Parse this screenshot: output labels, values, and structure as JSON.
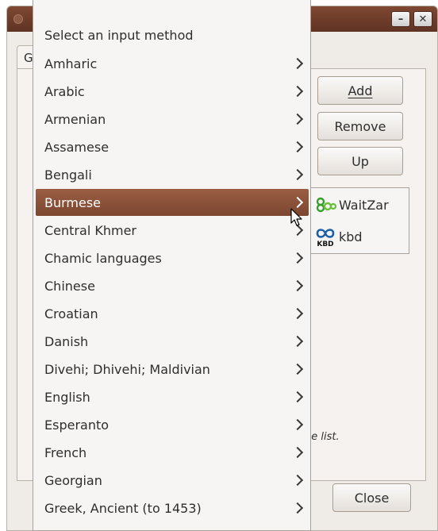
{
  "window": {
    "tab_label": "G",
    "buttons": {
      "add": "Add",
      "remove": "Remove",
      "up": "Up"
    },
    "hint_fragment": "he list.",
    "close_label": "Close",
    "titlebar_color": "#6e3d2a"
  },
  "menu": {
    "title": "Select an input method",
    "items": [
      {
        "label": "Amharic"
      },
      {
        "label": "Arabic"
      },
      {
        "label": "Armenian"
      },
      {
        "label": "Assamese"
      },
      {
        "label": "Bengali"
      },
      {
        "label": "Burmese",
        "selected": true
      },
      {
        "label": "Central Khmer"
      },
      {
        "label": "Chamic languages"
      },
      {
        "label": "Chinese"
      },
      {
        "label": "Croatian"
      },
      {
        "label": "Danish"
      },
      {
        "label": "Divehi; Dhivehi; Maldivian"
      },
      {
        "label": "English"
      },
      {
        "label": "Esperanto"
      },
      {
        "label": "French"
      },
      {
        "label": "Georgian"
      },
      {
        "label": "Greek, Ancient (to 1453)"
      }
    ],
    "selected_color": "#8b5139"
  },
  "submenu": {
    "items": [
      {
        "label": "WaitZar",
        "icon": "waitzar-icon"
      },
      {
        "label": "kbd",
        "icon": "kbd-icon",
        "icon_text": "KBD"
      }
    ]
  }
}
